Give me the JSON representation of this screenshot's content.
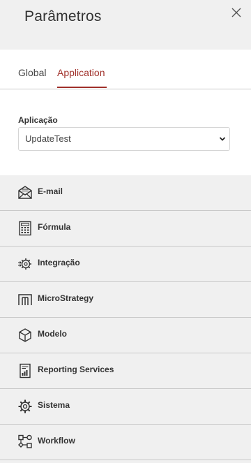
{
  "header": {
    "title": "Parâmetros",
    "close_icon": "close-icon"
  },
  "tabs": [
    {
      "label": "Global",
      "active": false
    },
    {
      "label": "Application",
      "active": true
    }
  ],
  "accent_color": "#a0302a",
  "application_field": {
    "label": "Aplicação",
    "selected_value": "UpdateTest"
  },
  "menu": [
    {
      "label": "E-mail",
      "icon": "email-icon"
    },
    {
      "label": "Fórmula",
      "icon": "calculator-icon"
    },
    {
      "label": "Integração",
      "icon": "integration-gear-icon"
    },
    {
      "label": "MicroStrategy",
      "icon": "microstrategy-icon"
    },
    {
      "label": "Modelo",
      "icon": "cube-icon"
    },
    {
      "label": "Reporting Services",
      "icon": "report-icon"
    },
    {
      "label": "Sistema",
      "icon": "gear-icon"
    },
    {
      "label": "Workflow",
      "icon": "workflow-icon"
    }
  ]
}
